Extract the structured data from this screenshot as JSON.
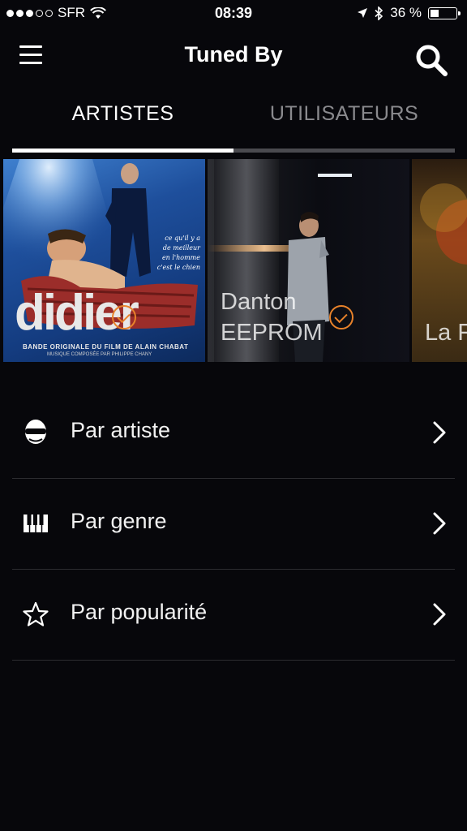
{
  "status": {
    "carrier": "SFR",
    "time": "08:39",
    "battery_percent": "36 %",
    "battery_level": 0.36,
    "signal_bars_filled": 3,
    "signal_bars_total": 5
  },
  "nav": {
    "title": "Tuned By"
  },
  "tabs": [
    {
      "label": "ARTISTES",
      "active": true
    },
    {
      "label": "UTILISATEURS",
      "active": false
    }
  ],
  "artists": [
    {
      "name_line1": "",
      "name_line2": "",
      "album_title": "didier",
      "album_subtitle": "BANDE ORIGINALE DU FILM DE ALAIN CHABAT",
      "album_caption": "MUSIQUE COMPOSÉE PAR PHILIPPE CHANY",
      "album_quote": [
        "ce qu'il y a",
        "de meilleur",
        "en l'homme",
        "c'est le chien"
      ],
      "selected": true
    },
    {
      "name_line1": "Danton",
      "name_line2": "EEPROM",
      "selected": true
    },
    {
      "name_line1": "La F",
      "name_line2": "",
      "selected": false
    }
  ],
  "menu": [
    {
      "label": "Par artiste",
      "icon": "artist-mask-icon"
    },
    {
      "label": "Par genre",
      "icon": "piano-keys-icon"
    },
    {
      "label": "Par popularité",
      "icon": "star-outline-icon"
    }
  ],
  "colors": {
    "background": "#07070b",
    "accent": "#e8822a",
    "tab_inactive": "#8a8a8e",
    "divider": "#2c2c30"
  }
}
